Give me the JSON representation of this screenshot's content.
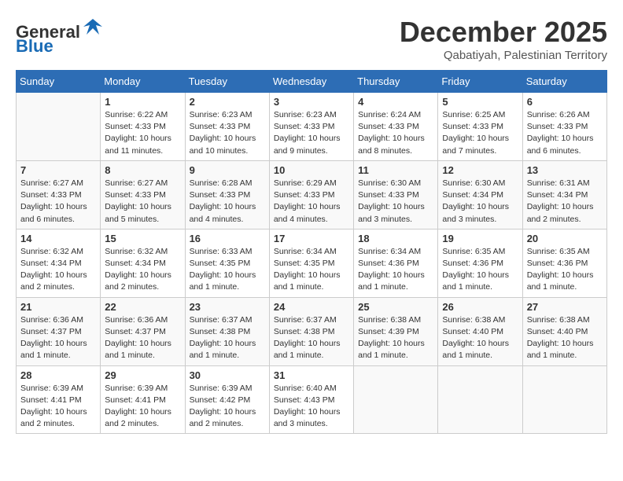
{
  "logo": {
    "general": "General",
    "blue": "Blue"
  },
  "header": {
    "month": "December 2025",
    "location": "Qabatiyah, Palestinian Territory"
  },
  "days_of_week": [
    "Sunday",
    "Monday",
    "Tuesday",
    "Wednesday",
    "Thursday",
    "Friday",
    "Saturday"
  ],
  "weeks": [
    [
      {
        "day": "",
        "info": ""
      },
      {
        "day": "1",
        "info": "Sunrise: 6:22 AM\nSunset: 4:33 PM\nDaylight: 10 hours\nand 11 minutes."
      },
      {
        "day": "2",
        "info": "Sunrise: 6:23 AM\nSunset: 4:33 PM\nDaylight: 10 hours\nand 10 minutes."
      },
      {
        "day": "3",
        "info": "Sunrise: 6:23 AM\nSunset: 4:33 PM\nDaylight: 10 hours\nand 9 minutes."
      },
      {
        "day": "4",
        "info": "Sunrise: 6:24 AM\nSunset: 4:33 PM\nDaylight: 10 hours\nand 8 minutes."
      },
      {
        "day": "5",
        "info": "Sunrise: 6:25 AM\nSunset: 4:33 PM\nDaylight: 10 hours\nand 7 minutes."
      },
      {
        "day": "6",
        "info": "Sunrise: 6:26 AM\nSunset: 4:33 PM\nDaylight: 10 hours\nand 6 minutes."
      }
    ],
    [
      {
        "day": "7",
        "info": "Sunrise: 6:27 AM\nSunset: 4:33 PM\nDaylight: 10 hours\nand 6 minutes."
      },
      {
        "day": "8",
        "info": "Sunrise: 6:27 AM\nSunset: 4:33 PM\nDaylight: 10 hours\nand 5 minutes."
      },
      {
        "day": "9",
        "info": "Sunrise: 6:28 AM\nSunset: 4:33 PM\nDaylight: 10 hours\nand 4 minutes."
      },
      {
        "day": "10",
        "info": "Sunrise: 6:29 AM\nSunset: 4:33 PM\nDaylight: 10 hours\nand 4 minutes."
      },
      {
        "day": "11",
        "info": "Sunrise: 6:30 AM\nSunset: 4:33 PM\nDaylight: 10 hours\nand 3 minutes."
      },
      {
        "day": "12",
        "info": "Sunrise: 6:30 AM\nSunset: 4:34 PM\nDaylight: 10 hours\nand 3 minutes."
      },
      {
        "day": "13",
        "info": "Sunrise: 6:31 AM\nSunset: 4:34 PM\nDaylight: 10 hours\nand 2 minutes."
      }
    ],
    [
      {
        "day": "14",
        "info": "Sunrise: 6:32 AM\nSunset: 4:34 PM\nDaylight: 10 hours\nand 2 minutes."
      },
      {
        "day": "15",
        "info": "Sunrise: 6:32 AM\nSunset: 4:34 PM\nDaylight: 10 hours\nand 2 minutes."
      },
      {
        "day": "16",
        "info": "Sunrise: 6:33 AM\nSunset: 4:35 PM\nDaylight: 10 hours\nand 1 minute."
      },
      {
        "day": "17",
        "info": "Sunrise: 6:34 AM\nSunset: 4:35 PM\nDaylight: 10 hours\nand 1 minute."
      },
      {
        "day": "18",
        "info": "Sunrise: 6:34 AM\nSunset: 4:36 PM\nDaylight: 10 hours\nand 1 minute."
      },
      {
        "day": "19",
        "info": "Sunrise: 6:35 AM\nSunset: 4:36 PM\nDaylight: 10 hours\nand 1 minute."
      },
      {
        "day": "20",
        "info": "Sunrise: 6:35 AM\nSunset: 4:36 PM\nDaylight: 10 hours\nand 1 minute."
      }
    ],
    [
      {
        "day": "21",
        "info": "Sunrise: 6:36 AM\nSunset: 4:37 PM\nDaylight: 10 hours\nand 1 minute."
      },
      {
        "day": "22",
        "info": "Sunrise: 6:36 AM\nSunset: 4:37 PM\nDaylight: 10 hours\nand 1 minute."
      },
      {
        "day": "23",
        "info": "Sunrise: 6:37 AM\nSunset: 4:38 PM\nDaylight: 10 hours\nand 1 minute."
      },
      {
        "day": "24",
        "info": "Sunrise: 6:37 AM\nSunset: 4:38 PM\nDaylight: 10 hours\nand 1 minute."
      },
      {
        "day": "25",
        "info": "Sunrise: 6:38 AM\nSunset: 4:39 PM\nDaylight: 10 hours\nand 1 minute."
      },
      {
        "day": "26",
        "info": "Sunrise: 6:38 AM\nSunset: 4:40 PM\nDaylight: 10 hours\nand 1 minute."
      },
      {
        "day": "27",
        "info": "Sunrise: 6:38 AM\nSunset: 4:40 PM\nDaylight: 10 hours\nand 1 minute."
      }
    ],
    [
      {
        "day": "28",
        "info": "Sunrise: 6:39 AM\nSunset: 4:41 PM\nDaylight: 10 hours\nand 2 minutes."
      },
      {
        "day": "29",
        "info": "Sunrise: 6:39 AM\nSunset: 4:41 PM\nDaylight: 10 hours\nand 2 minutes."
      },
      {
        "day": "30",
        "info": "Sunrise: 6:39 AM\nSunset: 4:42 PM\nDaylight: 10 hours\nand 2 minutes."
      },
      {
        "day": "31",
        "info": "Sunrise: 6:40 AM\nSunset: 4:43 PM\nDaylight: 10 hours\nand 3 minutes."
      },
      {
        "day": "",
        "info": ""
      },
      {
        "day": "",
        "info": ""
      },
      {
        "day": "",
        "info": ""
      }
    ]
  ]
}
